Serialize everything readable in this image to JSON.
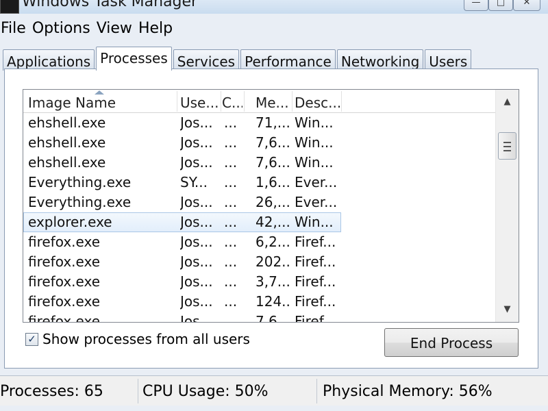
{
  "window": {
    "title": "Windows Task Manager",
    "controls": {
      "minimize": "—",
      "maximize": "□",
      "close": "✕"
    }
  },
  "menu": [
    "File",
    "Options",
    "View",
    "Help"
  ],
  "tabs": [
    {
      "label": "Applications",
      "active": false
    },
    {
      "label": "Processes",
      "active": true
    },
    {
      "label": "Services",
      "active": false
    },
    {
      "label": "Performance",
      "active": false
    },
    {
      "label": "Networking",
      "active": false
    },
    {
      "label": "Users",
      "active": false
    }
  ],
  "process_list": {
    "columns": [
      "Image Name",
      "Use...",
      "C...",
      "Me...",
      "Desc..."
    ],
    "sort_icon": "sort-ascending-icon",
    "rows": [
      [
        "ehshell.exe",
        "Jos...",
        "...",
        "71,...",
        "Win..."
      ],
      [
        "ehshell.exe",
        "Jos...",
        "...",
        "7,6...",
        "Win..."
      ],
      [
        "ehshell.exe",
        "Jos...",
        "...",
        "7,6...",
        "Win..."
      ],
      [
        "Everything.exe",
        "SY...",
        "...",
        "1,6...",
        "Ever..."
      ],
      [
        "Everything.exe",
        "Jos...",
        "...",
        "26,...",
        "Ever..."
      ],
      [
        "explorer.exe",
        "Jos...",
        "...",
        "42,...",
        "Win..."
      ],
      [
        "firefox.exe",
        "Jos...",
        "...",
        "6,2...",
        "Firef..."
      ],
      [
        "firefox.exe",
        "Jos...",
        "...",
        "202...",
        "Firef..."
      ],
      [
        "firefox.exe",
        "Jos...",
        "...",
        "3,7...",
        "Firef..."
      ],
      [
        "firefox.exe",
        "Jos...",
        "...",
        "124...",
        "Firef..."
      ],
      [
        "firefox.exe",
        "Jos...",
        "...",
        "7,6...",
        "Firef..."
      ]
    ],
    "selected_row": 5,
    "scroll": {
      "up": "▲",
      "down": "▼"
    }
  },
  "show_all_users": {
    "label": "Show processes from all users",
    "checked": true,
    "check_glyph": "✓"
  },
  "end_process": {
    "label": "End Process"
  },
  "status": {
    "processes": "Processes: 65",
    "cpu": "CPU Usage: 50%",
    "memory": "Physical Memory: 56%"
  },
  "colors": {
    "selection": "#e2eefb",
    "chrome": "#e9eef5",
    "accent_border": "#8a9bb3"
  }
}
